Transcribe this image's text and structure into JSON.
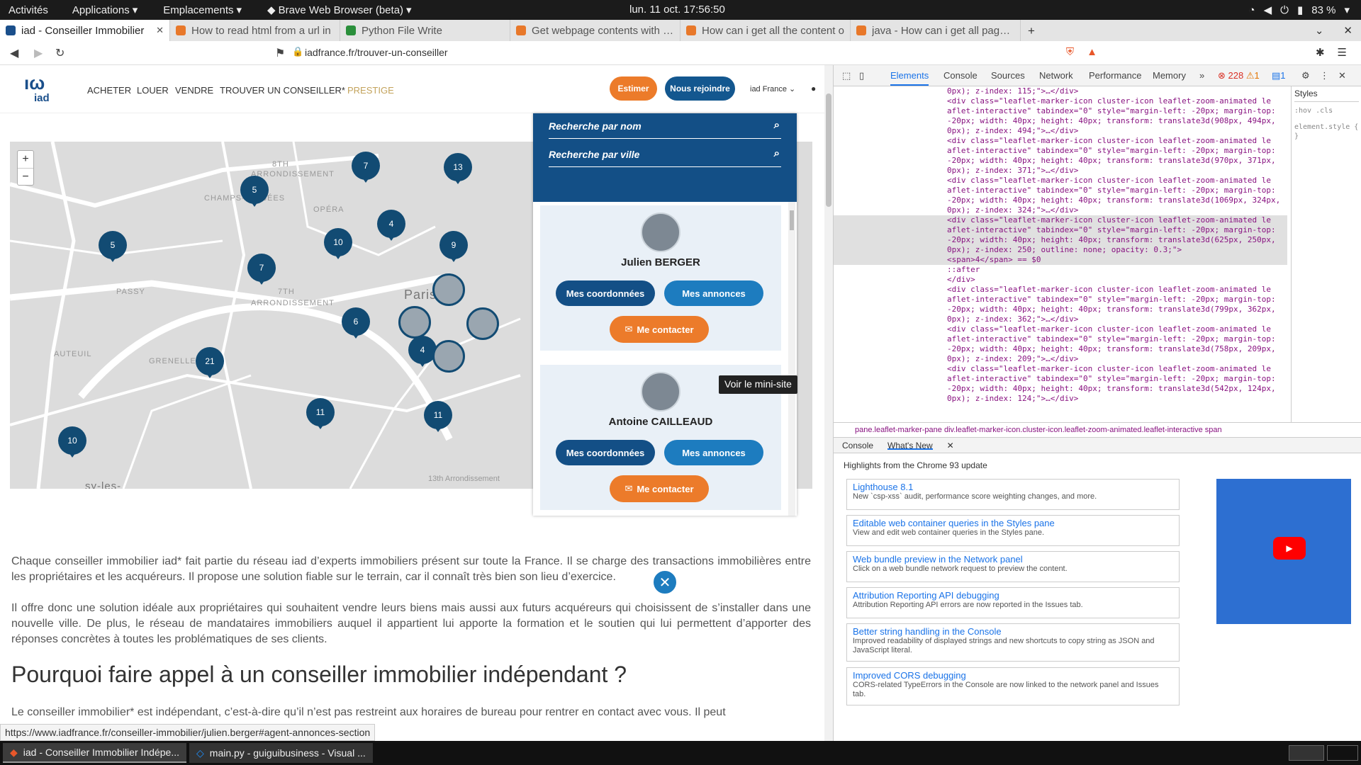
{
  "topbar": {
    "activities": "Activités",
    "applications": "Applications",
    "places": "Emplacements",
    "app": "Brave Web Browser (beta)",
    "clock": "lun. 11 oct.  17:56:50",
    "battery": "83 %"
  },
  "tabs": [
    {
      "label": "iad - Conseiller Immobilier"
    },
    {
      "label": "How to read html from a url in"
    },
    {
      "label": "Python File Write"
    },
    {
      "label": "Get webpage contents with Py"
    },
    {
      "label": "How can i get all the content o"
    },
    {
      "label": "java - How can i get all page C"
    }
  ],
  "address": {
    "url": "iadfrance.fr/trouver-un-conseiller"
  },
  "site": {
    "nav": [
      "ACHETER",
      "LOUER",
      "VENDRE",
      "TROUVER UN CONSEILLER*",
      "PRESTIGE"
    ],
    "estimer": "Estimer",
    "rejoindre": "Nous rejoindre",
    "lang": "iad France",
    "search_name": "Recherche par nom",
    "search_city": "Recherche par ville",
    "agents": [
      {
        "name": "Julien BERGER",
        "coords": "Mes coordonnées",
        "annonces": "Mes annonces",
        "contact": "Me contacter"
      },
      {
        "name": "Antoine CAILLEAUD",
        "coords": "Mes coordonnées",
        "annonces": "Mes annonces",
        "contact": "Me contacter"
      }
    ],
    "tooltip": "Voir le mini-site",
    "map_labels": [
      "8TH",
      "ARRONDISSEMENT",
      "CHAMPS-ÉLYSÉES",
      "OPÉRA",
      "PASSY",
      "7TH",
      "ARRONDISSEMENT",
      "AUTEUIL",
      "GRENELLE",
      "Paris",
      "13th Arrondissement",
      "sy-les-"
    ],
    "clusters": [
      "7",
      "13",
      "5",
      "4",
      "9",
      "5",
      "10",
      "7",
      "6",
      "4",
      "21",
      "11",
      "11",
      "10"
    ],
    "para1": "Chaque conseiller immobilier iad* fait partie du réseau iad d’experts immobiliers présent sur toute la France. Il se charge des transactions immobilières entre les propriétaires et les acquéreurs. Il propose une solution fiable sur le terrain, car il connaît très bien son lieu d’exercice.",
    "para2": "Il offre donc une solution idéale aux propriétaires qui souhaitent vendre leurs biens mais aussi aux futurs acquéreurs qui choisissent de s’installer dans une nouvelle ville. De plus, le réseau de mandataires immobiliers auquel il appartient lui apporte la formation et le soutien qui lui permettent d’apporter des réponses concrètes à toutes les problématiques de ses clients.",
    "h2": "Pourquoi faire appel à un conseiller immobilier indépendant ?",
    "para3": "Le conseiller immobilier* est indépendant, c’est-à-dire qu’il n’est pas restreint aux horaires de bureau pour rentrer en contact avec vous. Il peut"
  },
  "status_url": "https://www.iadfrance.fr/conseiller-immobilier/julien.berger#agent-annonces-section",
  "devtools": {
    "tabs": [
      "Elements",
      "Console",
      "Sources",
      "Network",
      "Performance",
      "Memory"
    ],
    "errors": "228",
    "warnings": "1",
    "msgs": "1",
    "lines": [
      "0px); z-index: 115;\">…</div>",
      "<div class=\"leaflet-marker-icon cluster-icon leaflet-zoom-animated le",
      "aflet-interactive\" tabindex=\"0\" style=\"margin-left: -20px; margin-top:",
      "-20px; width: 40px; height: 40px; transform: translate3d(908px, 494px,",
      "0px); z-index: 494;\">…</div>",
      "<div class=\"leaflet-marker-icon cluster-icon leaflet-zoom-animated le",
      "aflet-interactive\" tabindex=\"0\" style=\"margin-left: -20px; margin-top:",
      "-20px; width: 40px; height: 40px; transform: translate3d(970px, 371px,",
      "0px); z-index: 371;\">…</div>",
      "<div class=\"leaflet-marker-icon cluster-icon leaflet-zoom-animated le",
      "aflet-interactive\" tabindex=\"0\" style=\"margin-left: -20px; margin-top:",
      "-20px; width: 40px; height: 40px; transform: translate3d(1069px, 324px,",
      "0px); z-index: 324;\">…</div>",
      "<div class=\"leaflet-marker-icon cluster-icon leaflet-zoom-animated le",
      "aflet-interactive\" tabindex=\"0\" style=\"margin-left: -20px; margin-top:",
      "-20px; width: 40px; height: 40px; transform: translate3d(625px, 250px,",
      "0px); z-index: 250; outline: none; opacity: 0.3;\">",
      "<span>4</span> == $0",
      "::after",
      "</div>",
      "<div class=\"leaflet-marker-icon cluster-icon leaflet-zoom-animated le",
      "aflet-interactive\" tabindex=\"0\" style=\"margin-left: -20px; margin-top:",
      "-20px; width: 40px; height: 40px; transform: translate3d(799px, 362px,",
      "0px); z-index: 362;\">…</div>",
      "<div class=\"leaflet-marker-icon cluster-icon leaflet-zoom-animated le",
      "aflet-interactive\" tabindex=\"0\" style=\"margin-left: -20px; margin-top:",
      "-20px; width: 40px; height: 40px; transform: translate3d(758px, 209px,",
      "0px); z-index: 209;\">…</div>",
      "<div class=\"leaflet-marker-icon cluster-icon leaflet-zoom-animated le",
      "aflet-interactive\" tabindex=\"0\" style=\"margin-left: -20px; margin-top:",
      "-20px; width: 40px; height: 40px; transform: translate3d(542px, 124px,",
      "0px); z-index: 124;\">…</div>"
    ],
    "crumbs": "pane.leaflet-marker-pane   div.leaflet-marker-icon.cluster-icon.leaflet-zoom-animated.leaflet-interactive   span",
    "styles_title": "Styles",
    "drawer_tabs": [
      "Console",
      "What's New"
    ],
    "highlights": "Highlights from the Chrome 93 update",
    "whats_new": [
      {
        "t": "Lighthouse 8.1",
        "d": "New `csp-xss` audit, performance score weighting changes, and more."
      },
      {
        "t": "Editable web container queries in the Styles pane",
        "d": "View and edit web container queries in the Styles pane."
      },
      {
        "t": "Web bundle preview in the Network panel",
        "d": "Click on a web bundle network request to preview the content."
      },
      {
        "t": "Attribution Reporting API debugging",
        "d": "Attribution Reporting API errors are now reported in the Issues tab."
      },
      {
        "t": "Better string handling in the Console",
        "d": "Improved readability of displayed strings and new shortcuts to copy string as JSON and JavaScript literal."
      },
      {
        "t": "Improved CORS debugging",
        "d": "CORS-related TypeErrors in the Console are now linked to the network panel and Issues tab."
      }
    ]
  },
  "taskbar": [
    {
      "label": "iad - Conseiller Immobilier Indépe..."
    },
    {
      "label": "main.py - guiguibusiness - Visual ..."
    }
  ]
}
